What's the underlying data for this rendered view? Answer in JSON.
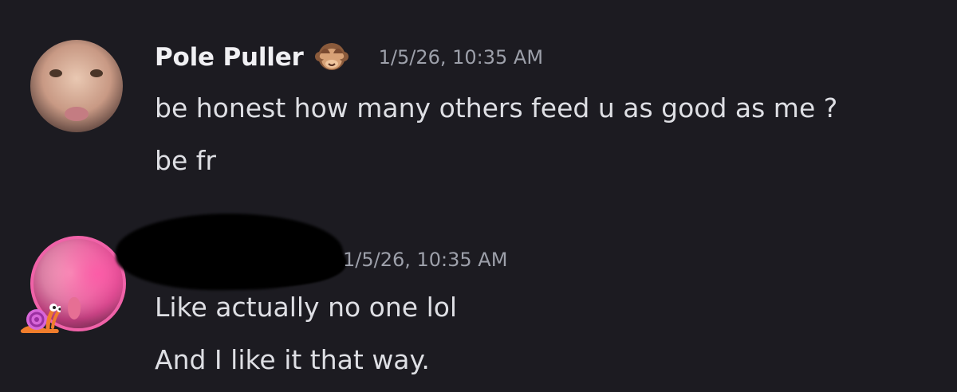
{
  "messages": [
    {
      "username": "Pole Puller",
      "badge_icon": "see-no-evil-monkey-icon",
      "timestamp": "1/5/26, 10:35 AM",
      "lines": [
        "be honest how many others feed u as good as me ?",
        "be fr"
      ]
    },
    {
      "username_redacted": true,
      "timestamp": "1/5/26, 10:35 AM",
      "lines": [
        "Like actually no one lol",
        "And I like it that way."
      ],
      "avatar_badge_icon": "snail-icon"
    }
  ],
  "colors": {
    "background": "#1c1b21",
    "username": "#f0f0f3",
    "message_text": "#dedfe4",
    "timestamp": "#9da0aa",
    "avatar_ring": "#f062a8"
  }
}
